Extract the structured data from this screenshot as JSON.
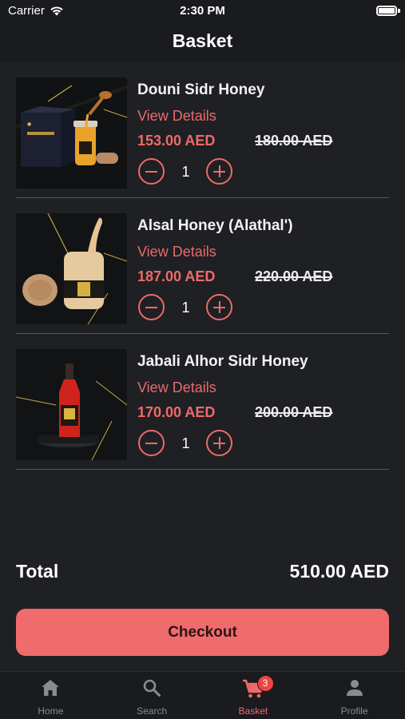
{
  "status_bar": {
    "carrier": "Carrier",
    "time": "2:30 PM"
  },
  "header": {
    "title": "Basket"
  },
  "items": [
    {
      "name": "Douni Sidr Honey",
      "view_details": "View Details",
      "price": "153.00 AED",
      "old_price": "180.00 AED",
      "quantity": "1"
    },
    {
      "name": "Alsal Honey (Alathal')",
      "view_details": "View Details",
      "price": "187.00 AED",
      "old_price": "220.00 AED",
      "quantity": "1"
    },
    {
      "name": "Jabali Alhor Sidr Honey",
      "view_details": "View Details",
      "price": "170.00 AED",
      "old_price": "200.00 AED",
      "quantity": "1"
    }
  ],
  "total": {
    "label": "Total",
    "value": "510.00 AED"
  },
  "checkout": {
    "label": "Checkout"
  },
  "tabs": [
    {
      "label": "Home",
      "icon": "home-icon"
    },
    {
      "label": "Search",
      "icon": "search-icon"
    },
    {
      "label": "Basket",
      "icon": "cart-icon",
      "badge": "3"
    },
    {
      "label": "Profile",
      "icon": "person-icon"
    }
  ],
  "colors": {
    "accent": "#ef6a6a",
    "background": "#1f2023",
    "bar": "#1a1b1e"
  }
}
